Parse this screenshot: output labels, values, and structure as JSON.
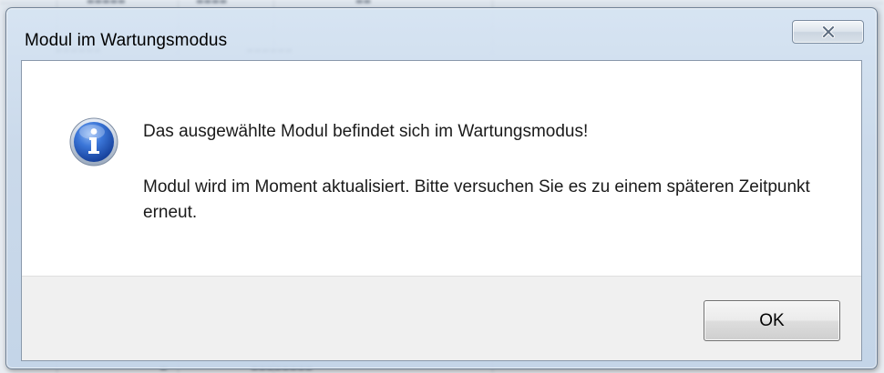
{
  "window": {
    "title": "Modul im Wartungsmodus",
    "close_icon": "close-x-icon"
  },
  "message": {
    "icon": "info-icon",
    "main": "Das ausgewählte Modul befindet sich im Wartungsmodus!",
    "detail": "Modul wird im Moment aktualisiert. Bitte versuchen Sie es zu einem späteren Zeitpunkt erneut."
  },
  "buttons": {
    "ok_label": "OK"
  },
  "colors": {
    "frame": "#c8d8ea",
    "info_icon_blue": "#2a62c9",
    "footer": "#f0f0f0"
  }
}
